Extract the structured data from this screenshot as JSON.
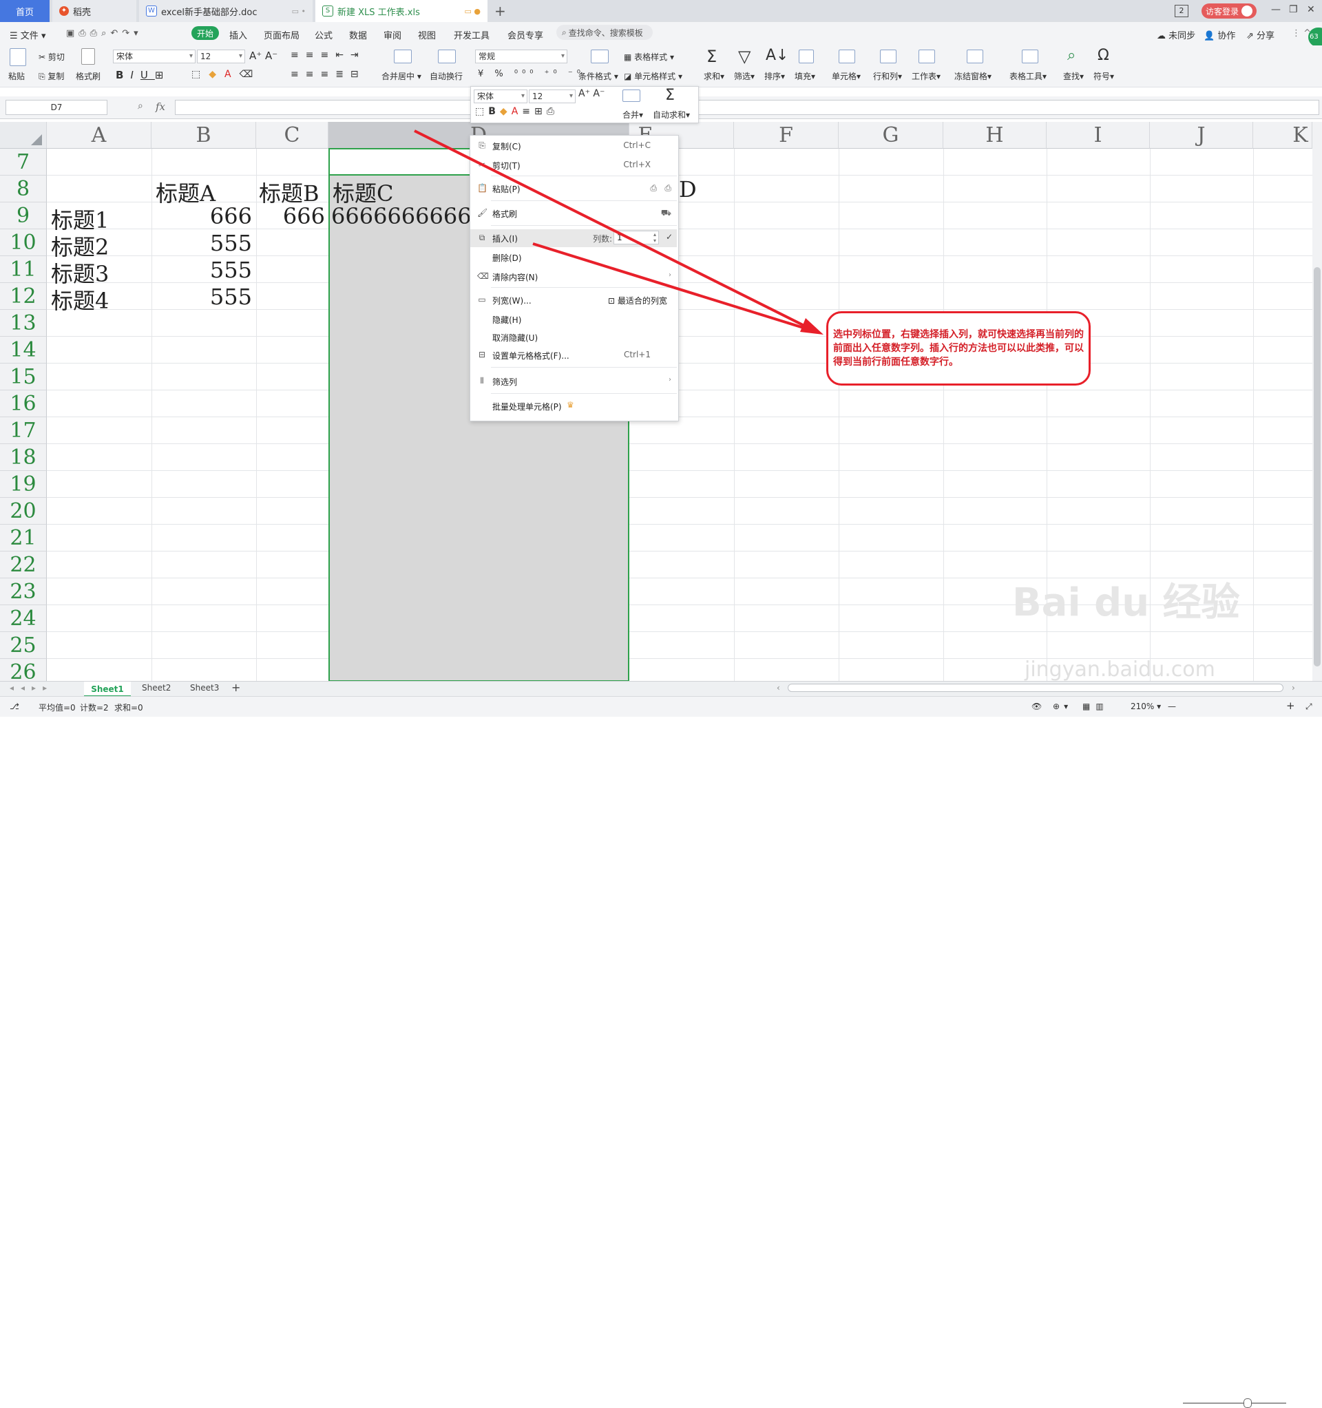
{
  "titlebar": {
    "tabs": [
      {
        "label": "首页"
      },
      {
        "label": "稻壳"
      },
      {
        "label": "excel新手基础部分.doc"
      },
      {
        "label": "新建 XLS 工作表.xls"
      }
    ],
    "badge": "2",
    "login": "访客登录"
  },
  "menubar": {
    "file": "文件",
    "start": "开始",
    "items": [
      "插入",
      "页面布局",
      "公式",
      "数据",
      "审阅",
      "视图",
      "开发工具",
      "会员专享"
    ],
    "search": "查找命令、搜索模板",
    "right": [
      "未同步",
      "协作",
      "分享"
    ]
  },
  "ribbon": {
    "paste": "粘贴",
    "cut": "剪切",
    "copy": "复制",
    "format_painter": "格式刷",
    "font": "宋体",
    "size": "12",
    "number_format": "常规",
    "merge": "合并居中",
    "wrap": "自动换行",
    "cond_format": "条件格式",
    "table_style": "表格样式",
    "cell_style": "单元格样式",
    "sum": "求和",
    "filter": "筛选",
    "sort": "排序",
    "fill": "填充",
    "cell": "单元格",
    "rowcol": "行和列",
    "sheet": "工作表",
    "freeze": "冻结窗格",
    "table_tools": "表格工具",
    "find": "查找",
    "symbol": "符号"
  },
  "formula_bar": {
    "name_box": "D7",
    "fx": "fx"
  },
  "grid": {
    "columns": [
      "A",
      "B",
      "C",
      "D",
      "E",
      "F",
      "G",
      "H",
      "I",
      "J",
      "K"
    ],
    "rows": [
      "7",
      "8",
      "9",
      "10",
      "11",
      "12",
      "13",
      "14",
      "15",
      "16",
      "17",
      "18",
      "19",
      "20",
      "21",
      "22",
      "23",
      "24",
      "25",
      "26"
    ],
    "cells": {
      "B8": "标题A",
      "C8": "标题B",
      "D8": "标题C",
      "E8": "D",
      "A9": "标题1",
      "B9": "666",
      "C9": "666",
      "D9": "666666666666",
      "A10": "标题2",
      "B10": "555",
      "A11": "标题3",
      "B11": "555",
      "A12": "标题4",
      "B12": "555"
    }
  },
  "mini_toolbar": {
    "font": "宋体",
    "size": "12",
    "merge": "合并",
    "autosum": "自动求和"
  },
  "context_menu": {
    "copy": "复制(C)",
    "copy_sc": "Ctrl+C",
    "cut": "剪切(T)",
    "cut_sc": "Ctrl+X",
    "paste": "粘贴(P)",
    "painter": "格式刷",
    "insert": "插入(I)",
    "insert_count_label": "列数:",
    "insert_count": "1",
    "delete": "删除(D)",
    "clear": "清除内容(N)",
    "col_width": "列宽(W)...",
    "best_fit": "最适合的列宽",
    "hide": "隐藏(H)",
    "unhide": "取消隐藏(U)",
    "format_cells": "设置单元格格式(F)...",
    "format_sc": "Ctrl+1",
    "filter_col": "筛选列",
    "batch": "批量处理单元格(P)"
  },
  "annotation": {
    "text": "选中列标位置，右键选择插入列，就可快速选择再当前列的前面出入任意数字列。插入行的方法也可以以此类推，可以得到当前行前面任意数字行。",
    "color": "#d41f27"
  },
  "sheets": [
    "Sheet1",
    "Sheet2",
    "Sheet3"
  ],
  "status": {
    "avg": "平均值=0",
    "count": "计数=2",
    "sum": "求和=0",
    "zoom": "210%"
  },
  "watermark": {
    "brand": "Bai du 经验",
    "url": "jingyan.baidu.com"
  }
}
